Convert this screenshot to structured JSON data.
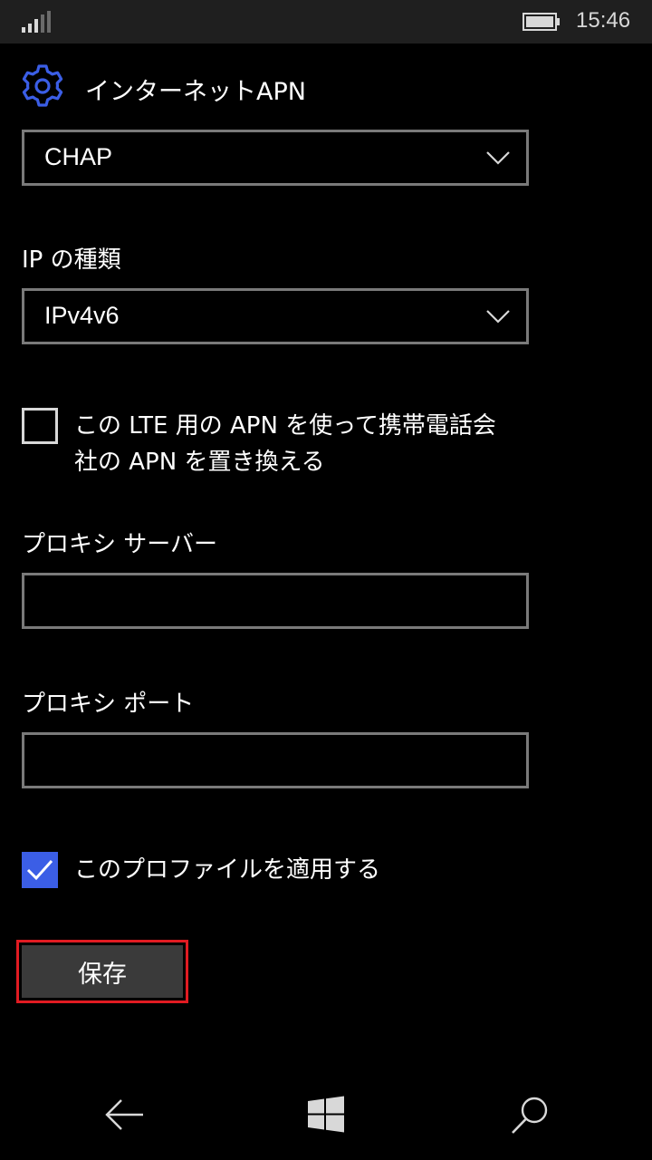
{
  "status_bar": {
    "time": "15:46",
    "signal_icon": "signal-bars-icon",
    "battery_icon": "battery-icon"
  },
  "header": {
    "icon": "gear-icon",
    "title": "インターネットAPN"
  },
  "auth_type": {
    "value": "CHAP"
  },
  "ip_type": {
    "label": "IP の種類",
    "value": "IPv4v6"
  },
  "lte_replace": {
    "checked": false,
    "label_line1": "この LTE 用の APN を使って携帯電話会",
    "label_line2": "社の APN を置き換える"
  },
  "proxy_server": {
    "label": "プロキシ サーバー",
    "value": ""
  },
  "proxy_port": {
    "label": "プロキシ ポート",
    "value": ""
  },
  "apply_profile": {
    "checked": true,
    "label": "このプロファイルを適用する"
  },
  "save_button": {
    "label": "保存",
    "highlight_color": "#e11b22"
  },
  "nav_bar": {
    "back_icon": "back-arrow-icon",
    "home_icon": "windows-logo-icon",
    "search_icon": "search-icon"
  },
  "colors": {
    "accent": "#3b5ee6",
    "background": "#000000"
  }
}
